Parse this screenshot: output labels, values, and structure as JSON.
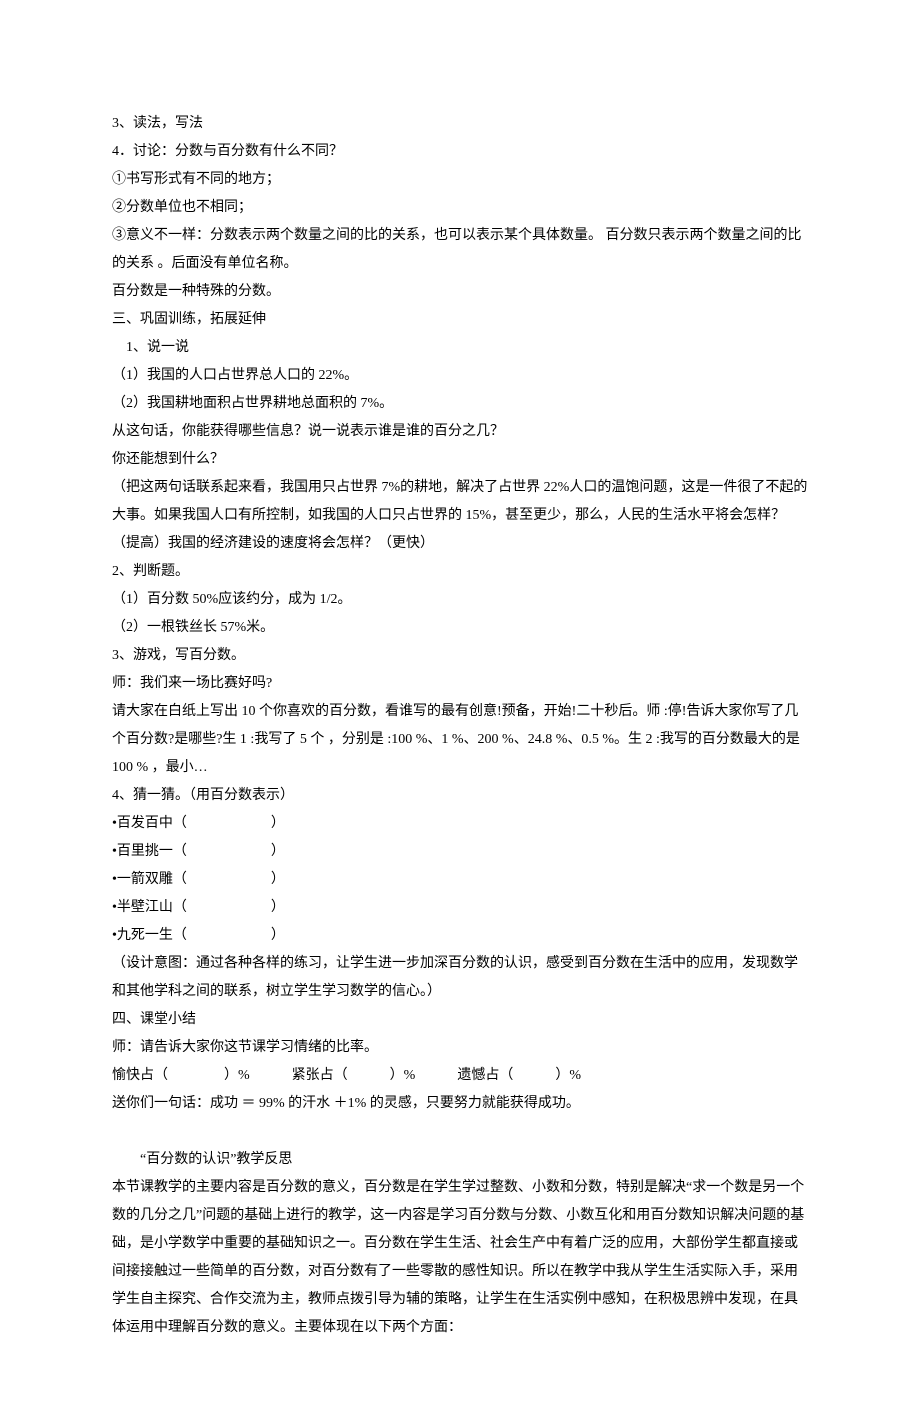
{
  "lines": [
    {
      "text": "3、读法，写法",
      "indent": 0
    },
    {
      "text": "4．讨论：分数与百分数有什么不同？",
      "indent": 0
    },
    {
      "text": "①书写形式有不同的地方；",
      "indent": 0
    },
    {
      "text": "②分数单位也不相同；",
      "indent": 0
    },
    {
      "text": "③意义不一样：分数表示两个数量之间的比的关系，也可以表示某个具体数量。 百分数只表示两个数量之间的比的关系 。后面没有单位名称。",
      "indent": 0
    },
    {
      "text": "百分数是一种特殊的分数。",
      "indent": 0
    },
    {
      "text": "三、巩固训练，拓展延伸",
      "indent": 0
    },
    {
      "text": "1、说一说",
      "indent": 1
    },
    {
      "text": "（1）我国的人口占世界总人口的 22%。",
      "indent": 0
    },
    {
      "text": "（2）我国耕地面积占世界耕地总面积的 7%。",
      "indent": 0
    },
    {
      "text": "从这句话，你能获得哪些信息？说一说表示谁是谁的百分之几？",
      "indent": 0
    },
    {
      "text": "你还能想到什么？",
      "indent": 0
    },
    {
      "text": "（把这两句话联系起来看，我国用只占世界 7%的耕地，解决了占世界 22%人口的温饱问题，这是一件很了不起的大事。如果我国人口有所控制，如我国的人口只占世界的 15%，甚至更少，那么，人民的生活水平将会怎样？（提高）我国的经济建设的速度将会怎样？（更快）",
      "indent": 0
    },
    {
      "text": "2、判断题。",
      "indent": 0
    },
    {
      "text": "（1）百分数 50%应该约分，成为 1/2。",
      "indent": 0
    },
    {
      "text": "（2）一根铁丝长 57%米。",
      "indent": 0
    },
    {
      "text": "3、游戏，写百分数。",
      "indent": 0
    },
    {
      "text": "师：我们来一场比赛好吗?",
      "indent": 0
    },
    {
      "text": "请大家在白纸上写出 10 个你喜欢的百分数，看谁写的最有创意!预备，开始!二十秒后。师 :停!告诉大家你写了几个百分数?是哪些?生 1 :我写了 5 个 ，分别是 :100 %、1 %、200 %、24.8 %、0.5 %。生 2 :我写的百分数最大的是 100 % ，最小…",
      "indent": 0
    },
    {
      "text": "4、猜一猜。（用百分数表示）",
      "indent": 0
    },
    {
      "text": "•百发百中（      ）",
      "indent": 0
    },
    {
      "text": "•百里挑一（      ）",
      "indent": 0
    },
    {
      "text": "•一箭双雕（      ）",
      "indent": 0
    },
    {
      "text": "•半壁江山（      ）",
      "indent": 0
    },
    {
      "text": "•九死一生（      ）",
      "indent": 0
    },
    {
      "text": "（设计意图：通过各种各样的练习，让学生进一步加深百分数的认识，感受到百分数在生活中的应用，发现数学和其他学科之间的联系，树立学生学习数学的信心。）",
      "indent": 0
    },
    {
      "text": "四、课堂小结",
      "indent": 0
    },
    {
      "text": "师：请告诉大家你这节课学习情绪的比率。",
      "indent": 0
    },
    {
      "text": "愉快占（    ）%   紧张占（   ）%   遗憾占（   ）%",
      "indent": 0
    },
    {
      "text": "送你们一句话：成功 ＝ 99% 的汗水 ＋1% 的灵感，只要努力就能获得成功。",
      "indent": 0
    },
    {
      "text": " ",
      "indent": 0
    },
    {
      "text": "  “百分数的认识”教学反思",
      "indent": 0
    },
    {
      "text": "本节课教学的主要内容是百分数的意义，百分数是在学生学过整数、小数和分数，特别是解决“求一个数是另一个数的几分之几”问题的基础上进行的教学，这一内容是学习百分数与分数、小数互化和用百分数知识解决问题的基础，是小学数学中重要的基础知识之一。百分数在学生生活、社会生产中有着广泛的应用，大部份学生都直接或间接接触过一些简单的百分数，对百分数有了一些零散的感性知识。所以在教学中我从学生生活实际入手，采用学生自主探究、合作交流为主，教师点拨引导为辅的策略，让学生在生活实例中感知，在积极思辨中发现，在具体运用中理解百分数的意义。主要体现在以下两个方面：",
      "indent": 0
    }
  ]
}
